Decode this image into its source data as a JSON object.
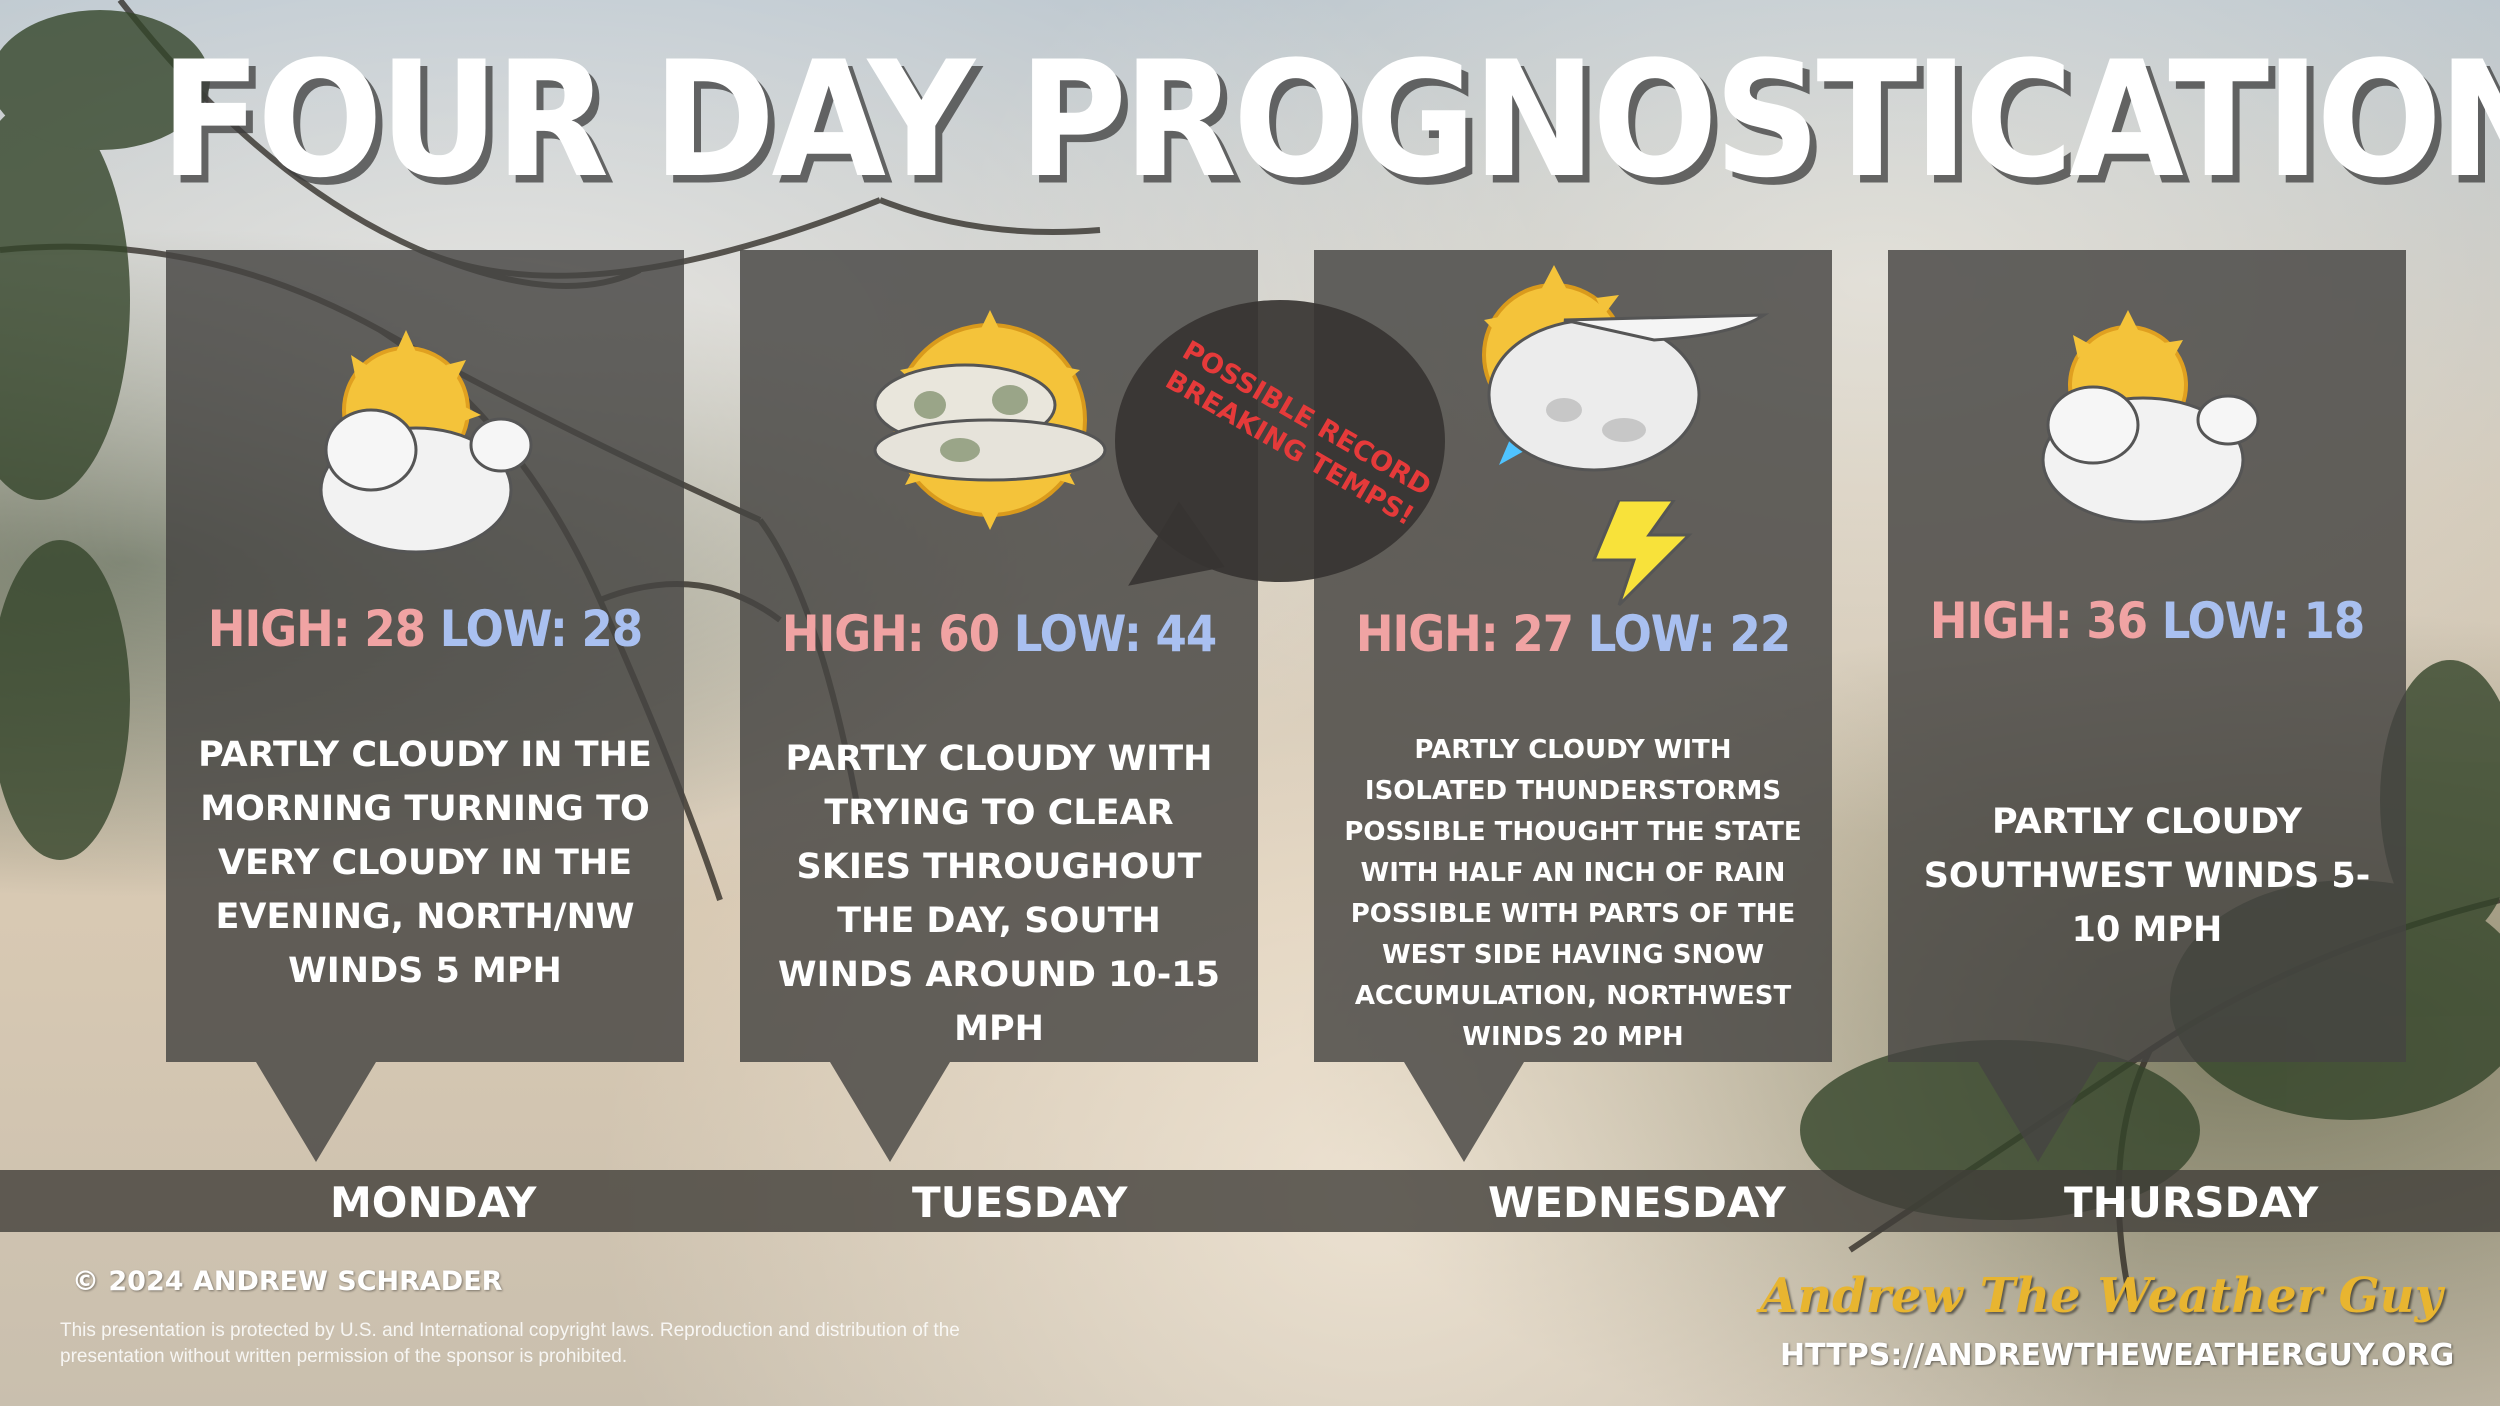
{
  "title": "FOUR DAY PROGNOSTICATION",
  "colors": {
    "high": "#f0a3a3",
    "low": "#a9c0f0",
    "card": "#464442",
    "callout_text": "#e53a3a",
    "brand": "#e8b530"
  },
  "callout": {
    "text": "POSSIBLE RECORD BREAKING TEMPS!"
  },
  "days": [
    {
      "name": "MONDAY",
      "icon": "partly-cloudy-icon",
      "high_label": "HIGH: 28",
      "low_label": "LOW: 28",
      "description": "PARTLY CLOUDY IN THE MORNING TURNING TO VERY CLOUDY IN THE EVENING, NORTH/NW WINDS 5 MPH"
    },
    {
      "name": "TUESDAY",
      "icon": "mostly-sunny-icon",
      "high_label": "HIGH: 60",
      "low_label": "LOW: 44",
      "description": "PARTLY CLOUDY WITH TRYING TO CLEAR SKIES THROUGHOUT THE DAY, SOUTH WINDS AROUND 10-15 MPH"
    },
    {
      "name": "WEDNESDAY",
      "icon": "thunderstorm-icon",
      "high_label": "HIGH: 27",
      "low_label": "LOW: 22",
      "description": "PARTLY CLOUDY WITH ISOLATED THUNDERSTORMS POSSIBLE THOUGHT THE STATE WITH HALF AN INCH OF RAIN POSSIBLE WITH PARTS OF THE WEST SIDE HAVING SNOW ACCUMULATION, NORTHWEST WINDS 20 MPH"
    },
    {
      "name": "THURSDAY",
      "icon": "partly-cloudy-icon",
      "high_label": "HIGH: 36",
      "low_label": "LOW: 18",
      "description": "PARTLY CLOUDY SOUTHWEST WINDS 5-10 MPH"
    }
  ],
  "footer": {
    "copyright": "© 2024 ANDREW SCHRADER",
    "legal": "This presentation is protected by U.S. and International copyright laws. Reproduction and distribution of the presentation without written permission of the sponsor is prohibited.",
    "brand": "Andrew The Weather Guy",
    "url": "HTTPS://ANDREWTHEWEATHERGUY.ORG"
  }
}
